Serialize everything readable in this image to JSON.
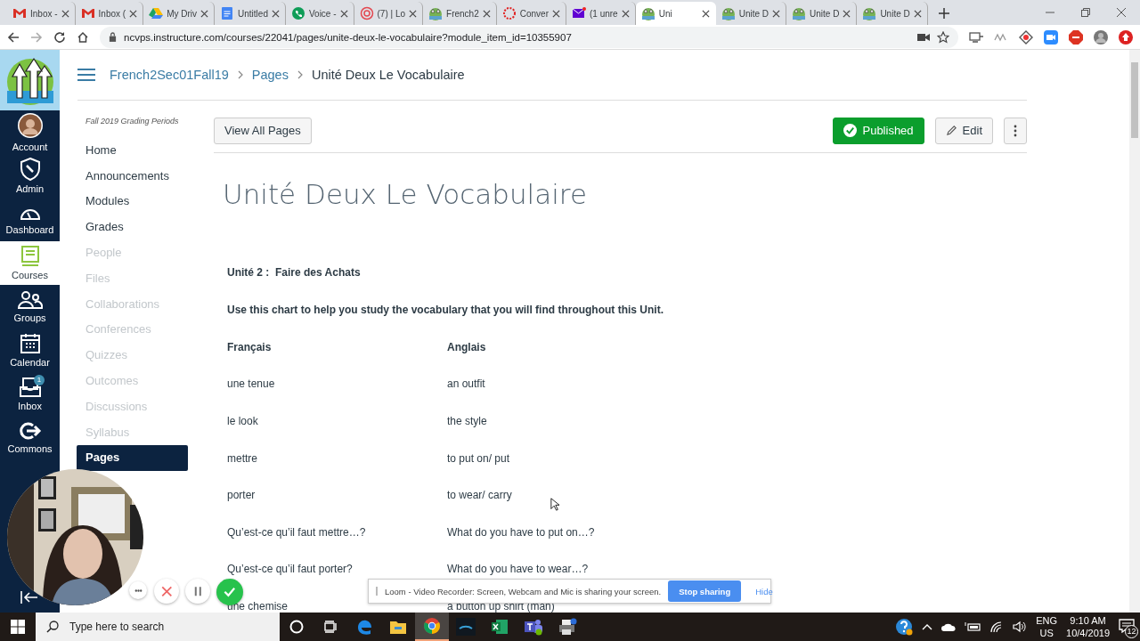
{
  "browser": {
    "tabs": [
      {
        "label": "Inbox -",
        "kind": "gmail",
        "selected": false
      },
      {
        "label": "Inbox (",
        "kind": "gmail",
        "selected": false
      },
      {
        "label": "My Driv",
        "kind": "drive",
        "selected": false
      },
      {
        "label": "Untitled",
        "kind": "docs",
        "selected": false
      },
      {
        "label": "Voice -",
        "kind": "voice",
        "selected": false
      },
      {
        "label": "(7) | Lo",
        "kind": "target",
        "selected": false
      },
      {
        "label": "French2",
        "kind": "canvas",
        "selected": false
      },
      {
        "label": "Conver",
        "kind": "ring",
        "selected": false
      },
      {
        "label": "(1 unre",
        "kind": "mail",
        "selected": false
      },
      {
        "label": "Uni",
        "kind": "canvas",
        "selected": true
      },
      {
        "label": "Unite D",
        "kind": "canvas",
        "selected": false
      },
      {
        "label": "Unite D",
        "kind": "canvas",
        "selected": false
      },
      {
        "label": "Unite D",
        "kind": "canvas",
        "selected": false
      }
    ],
    "url": "ncvps.instructure.com/courses/22041/pages/unite-deux-le-vocabulaire?module_item_id=10355907"
  },
  "global_nav": [
    {
      "label": "Account",
      "kind": "avatar",
      "selected": false
    },
    {
      "label": "Admin",
      "kind": "shield",
      "selected": false
    },
    {
      "label": "Dashboard",
      "kind": "gauge",
      "selected": false
    },
    {
      "label": "Courses",
      "kind": "book",
      "selected": true
    },
    {
      "label": "Groups",
      "kind": "people",
      "selected": false
    },
    {
      "label": "Calendar",
      "kind": "calendar",
      "selected": false
    },
    {
      "label": "Inbox",
      "kind": "inbox",
      "selected": false,
      "badge": "1"
    },
    {
      "label": "Commons",
      "kind": "commons",
      "selected": false
    }
  ],
  "breadcrumbs": [
    "French2Sec01Fall19",
    "Pages",
    "Unité Deux Le Vocabulaire"
  ],
  "course_nav": {
    "heading": "Fall 2019 Grading Periods",
    "items": [
      {
        "label": "Home",
        "disabled": false,
        "selected": false
      },
      {
        "label": "Announcements",
        "disabled": false,
        "selected": false
      },
      {
        "label": "Modules",
        "disabled": false,
        "selected": false
      },
      {
        "label": "Grades",
        "disabled": false,
        "selected": false
      },
      {
        "label": "People",
        "disabled": true,
        "selected": false
      },
      {
        "label": "Files",
        "disabled": true,
        "selected": false
      },
      {
        "label": "Collaborations",
        "disabled": true,
        "selected": false
      },
      {
        "label": "Conferences",
        "disabled": true,
        "selected": false
      },
      {
        "label": "Quizzes",
        "disabled": true,
        "selected": false
      },
      {
        "label": "Outcomes",
        "disabled": true,
        "selected": false
      },
      {
        "label": "Discussions",
        "disabled": true,
        "selected": false
      },
      {
        "label": "Syllabus",
        "disabled": true,
        "selected": false
      },
      {
        "label": "Pages",
        "disabled": false,
        "selected": true
      }
    ]
  },
  "toolbar": {
    "view_all": "View All Pages",
    "published": "Published",
    "edit": "Edit"
  },
  "page": {
    "title": "Unité Deux Le Vocabulaire",
    "subtitle": "Unité 2 :  Faire des Achats",
    "intro": "Use this chart to help you study the vocabulary that you will find throughout this Unit.",
    "columns": [
      "Français",
      "Anglais"
    ],
    "rows": [
      [
        "une tenue",
        "an outfit"
      ],
      [
        "le look",
        "the style"
      ],
      [
        "mettre",
        "to put on/ put"
      ],
      [
        "porter",
        "to wear/ carry"
      ],
      [
        "Qu’est-ce qu’il faut mettre…?",
        "What do you have to put on…?"
      ],
      [
        "Qu’est-ce qu’il faut porter?",
        "What do you have to wear…?"
      ],
      [
        "une chemise",
        "a button up shirt (man)"
      ]
    ]
  },
  "loom": {
    "message": "Loom - Video Recorder: Screen, Webcam and Mic is sharing your screen.",
    "stop": "Stop sharing",
    "hide": "Hide"
  },
  "taskbar": {
    "search_placeholder": "Type here to search",
    "apps": [
      {
        "kind": "edge",
        "selected": false
      },
      {
        "kind": "folder",
        "selected": false
      },
      {
        "kind": "chrome",
        "selected": true
      },
      {
        "kind": "sling",
        "selected": false
      },
      {
        "kind": "excel",
        "selected": false
      },
      {
        "kind": "teams",
        "selected": false
      },
      {
        "kind": "printer",
        "selected": false
      }
    ],
    "language": "ENG",
    "region": "US",
    "time": "9:10 AM",
    "date": "10/4/2019",
    "notifications": "12"
  }
}
